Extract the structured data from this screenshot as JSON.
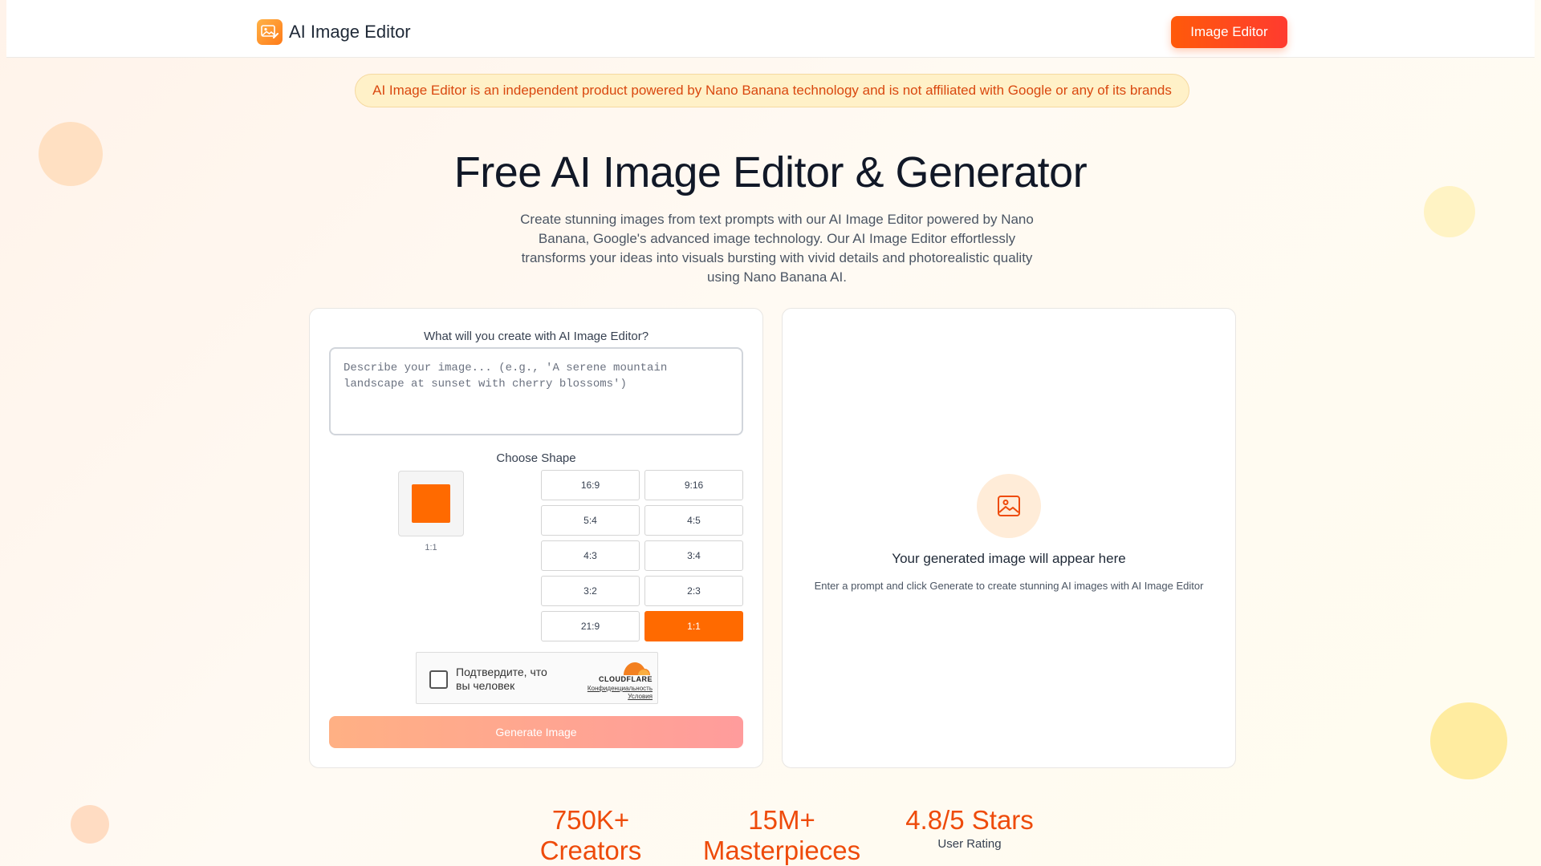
{
  "header": {
    "brand_name": "AI Image Editor",
    "logo_icon": "image-editor-logo-icon",
    "nav_button": "Image Editor"
  },
  "notice": "AI Image Editor is an independent product powered by Nano Banana technology and is not affiliated with Google or any of its brands",
  "hero": {
    "title": "Free AI Image Editor & Generator",
    "subtitle": "Create stunning images from text prompts with our AI Image Editor powered by Nano Banana, Google's advanced image technology. Our AI Image Editor effortlessly transforms your ideas into visuals bursting with vivid details and photorealistic quality using Nano Banana AI."
  },
  "form": {
    "question": "What will you create with AI Image Editor?",
    "prompt_value": "",
    "prompt_placeholder": "Describe your image... (e.g., 'A serene mountain landscape at sunset with cherry blossoms')",
    "shape_label": "Choose Shape",
    "preview_caption": "1:1",
    "ratios": [
      "16:9",
      "9:16",
      "5:4",
      "4:5",
      "4:3",
      "3:4",
      "3:2",
      "2:3",
      "21:9",
      "1:1"
    ],
    "selected_ratio": "1:1",
    "captcha": {
      "text_line1": "Подтвердите, что",
      "text_line2": "вы человек",
      "brand": "CLOUDFLARE",
      "link1": "Конфиденциальность",
      "link2": "Условия"
    },
    "generate_button": "Generate Image"
  },
  "result": {
    "icon": "image-placeholder-icon",
    "title": "Your generated image will appear here",
    "subtitle": "Enter a prompt and click Generate to create stunning AI images with AI Image Editor"
  },
  "stats": [
    {
      "value": "750K+",
      "label": "Creators"
    },
    {
      "value": "15M+",
      "label": "Masterpieces"
    },
    {
      "value": "4.8/5 Stars",
      "label": "User Rating"
    }
  ],
  "colors": {
    "accent": "#ff6a00",
    "notice_text": "#d9480f",
    "stat_text": "#ee4b0b"
  }
}
